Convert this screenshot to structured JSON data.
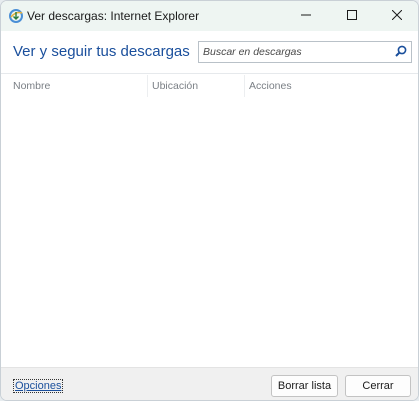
{
  "window": {
    "title": "Ver descargas: Internet Explorer"
  },
  "header": {
    "title": "Ver y seguir tus descargas"
  },
  "search": {
    "placeholder": "Buscar en descargas",
    "value": ""
  },
  "list": {
    "columns": [
      "Nombre",
      "Ubicación",
      "Acciones"
    ],
    "rows": []
  },
  "footer": {
    "options_label": "Opciones",
    "clear_label": "Borrar lista",
    "close_label": "Cerrar"
  },
  "icons": {
    "app": "ie-downloads-icon",
    "search": "search-icon",
    "minimize": "minimize-icon",
    "maximize": "maximize-icon",
    "close": "close-icon"
  },
  "colors": {
    "accent": "#1a4f9c",
    "titlebar": "#eef5f2",
    "footer": "#f0f0f0"
  }
}
